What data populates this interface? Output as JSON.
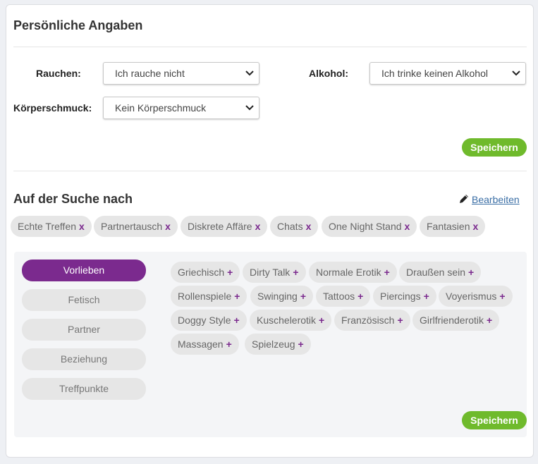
{
  "personal": {
    "title": "Persönliche Angaben",
    "smoking_label": "Rauchen:",
    "smoking_value": "Ich rauche nicht",
    "alcohol_label": "Alkohol:",
    "alcohol_value": "Ich trinke keinen Alkohol",
    "jewelry_label": "Körperschmuck:",
    "jewelry_value": "Kein Körperschmuck",
    "save_label": "Speichern"
  },
  "search": {
    "title": "Auf der Suche nach",
    "edit_label": "Bearbeiten",
    "remove_mark": "x",
    "tags": [
      "Echte Treffen",
      "Partnertausch",
      "Diskrete Affäre",
      "Chats",
      "One Night Stand",
      "Fantasien"
    ]
  },
  "preferences": {
    "categories": [
      "Vorlieben",
      "Fetisch",
      "Partner",
      "Beziehung",
      "Treffpunkte"
    ],
    "active_category": "Vorlieben",
    "add_mark": "+",
    "options": [
      "Griechisch",
      "Dirty Talk",
      "Normale Erotik",
      "Draußen sein",
      "Rollenspiele",
      "Swinging",
      "Tattoos",
      "Piercings",
      "Voyerismus",
      "Doggy Style",
      "Kuschelerotik",
      "Französisch",
      "Girlfrienderotik",
      "Massagen",
      "Spielzeug"
    ],
    "save_label": "Speichern"
  },
  "colors": {
    "accent": "#7b2a8e",
    "save_button": "#6fba2c",
    "link": "#3a6ea5"
  },
  "icons": {
    "edit": "pencil-icon",
    "select_arrow": "chevron-down-icon"
  }
}
